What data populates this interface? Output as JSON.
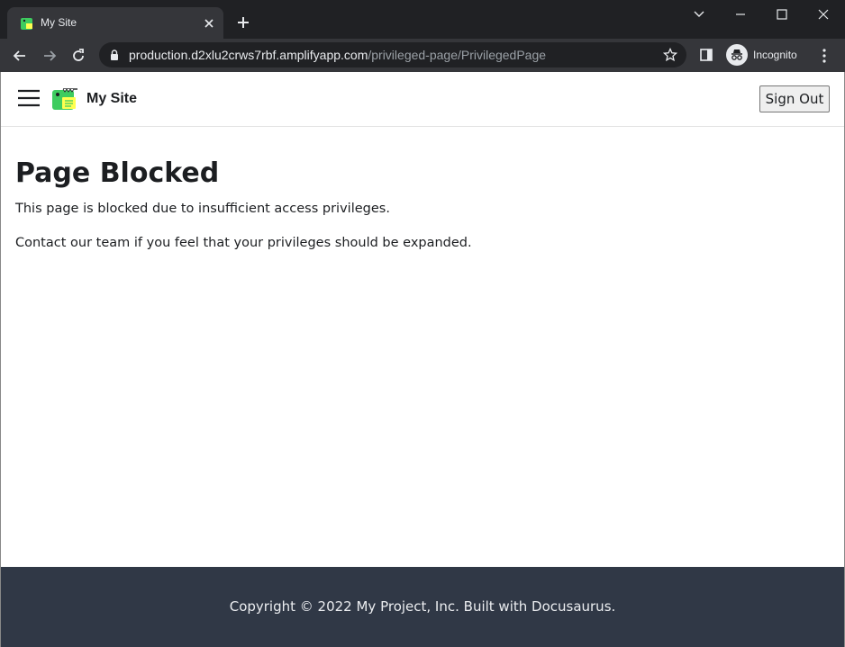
{
  "browser": {
    "tab_title": "My Site",
    "url_host": "production.d2xlu2crws7rbf.amplifyapp.com",
    "url_path": "/privileged-page/PrivilegedPage",
    "incognito_label": "Incognito"
  },
  "navbar": {
    "brand": "My Site",
    "sign_out_label": "Sign Out"
  },
  "main": {
    "title": "Page Blocked",
    "paragraph1": "This page is blocked due to insufficient access privileges.",
    "paragraph2": "Contact our team if you feel that your privileges should be expanded."
  },
  "footer": {
    "copyright": "Copyright © 2022 My Project, Inc. Built with Docusaurus."
  },
  "colors": {
    "chrome_dark": "#202124",
    "chrome_toolbar": "#35363a",
    "footer_bg": "#303846",
    "text": "#1c1e21"
  }
}
